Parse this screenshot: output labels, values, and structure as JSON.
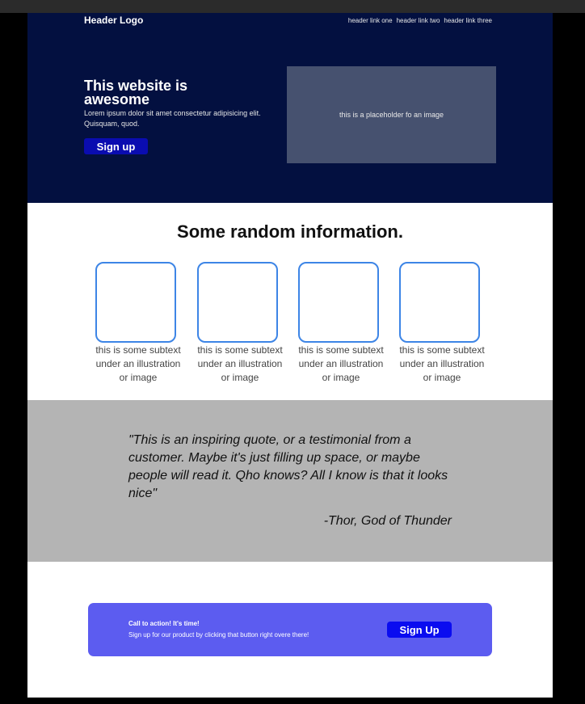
{
  "header": {
    "logo": "Header Logo",
    "links": [
      "header link one",
      "header link two",
      "header link three"
    ]
  },
  "hero": {
    "title": "This website is awesome",
    "text": "Lorem ipsum dolor sit amet consectetur adipisicing elit. Quisquam, quod.",
    "signup_label": "Sign up",
    "image_placeholder": "this is a placeholder fo an image"
  },
  "info": {
    "title": "Some random information.",
    "cards": [
      {
        "text": "this is some subtext under an illustration or image"
      },
      {
        "text": "this is some subtext under an illustration or image"
      },
      {
        "text": "this is some subtext under an illustration or image"
      },
      {
        "text": "this is some subtext under an illustration or image"
      }
    ]
  },
  "quote": {
    "text": "\"This is an inspiring quote, or a testimonial from a customer. Maybe it's just filling up space, or maybe people will read it. Qho knows? All I know is that it looks nice\"",
    "author": "-Thor, God of Thunder"
  },
  "cta": {
    "title": "Call to action! It's time!",
    "text": "Sign up for our product by clicking that button right overe there!",
    "button_label": "Sign Up"
  },
  "colors": {
    "hero_bg": "#031040",
    "image_placeholder_bg": "#46516f",
    "signup_button": "#0a0cb0",
    "card_border": "#3d85e6",
    "quote_bg": "#b4b4b4",
    "cta_bg": "#5c5cf0",
    "cta_button": "#0a0cf0"
  }
}
